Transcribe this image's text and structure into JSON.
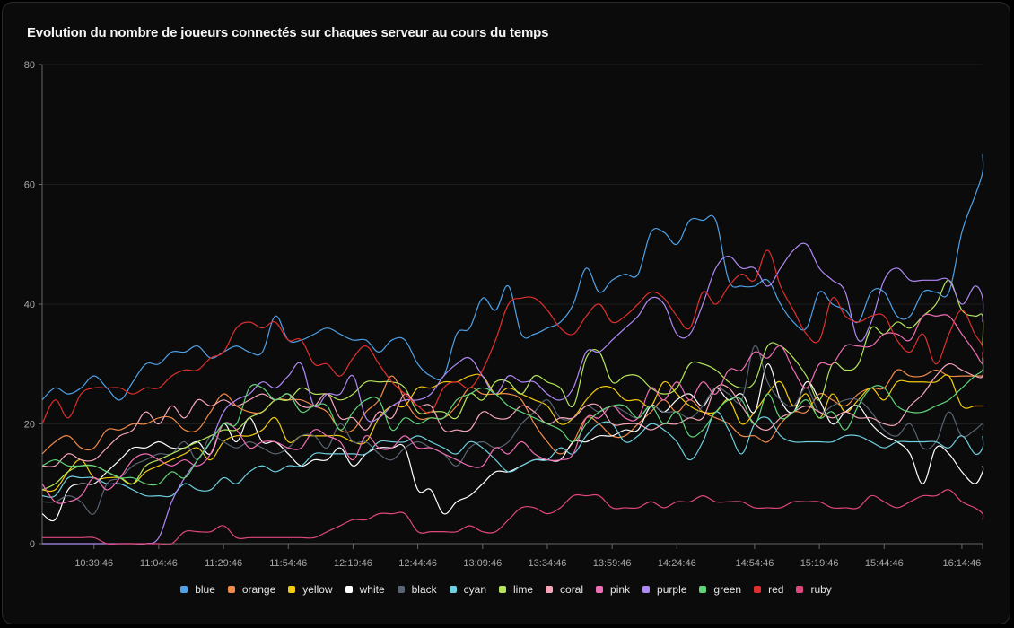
{
  "panel": {
    "title": "Evolution du nombre de joueurs connectés sur chaques serveur au cours du temps"
  },
  "chart_data": {
    "type": "line",
    "title": "Evolution du nombre de joueurs connectés sur chaques serveur au cours du temps",
    "xlabel": "",
    "ylabel": "",
    "ylim": [
      0,
      80
    ],
    "yticks": [
      0,
      20,
      40,
      60,
      80
    ],
    "xticks": [
      "10:39:46",
      "11:04:46",
      "11:29:46",
      "11:54:46",
      "12:19:46",
      "12:44:46",
      "13:09:46",
      "13:34:46",
      "13:59:46",
      "14:24:46",
      "14:54:46",
      "15:19:46",
      "15:44:46",
      "16:14:46"
    ],
    "x_start": "10:19:46",
    "x_step_minutes": 5,
    "x_domain": [
      "10:19:46",
      "16:22:46"
    ],
    "grid": true,
    "legend_position": "bottom",
    "series": [
      {
        "name": "blue",
        "color": "#4ea2e8",
        "values": [
          24,
          26,
          25,
          26,
          28,
          26,
          24,
          27,
          30,
          30,
          32,
          32,
          33,
          31,
          32,
          33,
          32,
          32,
          38,
          34,
          34,
          35,
          36,
          35,
          34,
          34,
          32,
          34,
          34,
          30,
          28,
          28,
          35,
          36,
          41,
          39,
          43,
          35,
          35,
          36,
          37,
          40,
          46,
          42,
          44,
          45,
          45,
          52,
          52,
          50,
          54,
          54,
          54,
          44,
          43,
          43,
          44,
          40,
          37,
          36,
          42,
          40,
          39,
          37,
          42,
          42,
          38,
          38,
          42,
          42,
          42,
          52,
          58,
          62,
          65
        ]
      },
      {
        "name": "orange",
        "color": "#f08a47",
        "values": [
          15,
          17,
          18,
          16,
          16,
          19,
          19,
          20,
          20,
          21,
          21,
          19,
          19,
          22,
          25,
          23,
          22,
          22,
          24,
          24,
          24,
          23,
          22,
          19,
          19,
          22,
          24,
          28,
          24,
          21,
          21,
          21,
          23,
          26,
          25,
          25,
          25,
          24,
          20,
          17,
          15,
          17,
          21,
          20,
          18,
          18,
          20,
          22,
          24,
          22,
          24,
          22,
          21,
          20,
          18,
          18,
          17,
          20,
          22,
          22,
          25,
          24,
          23,
          25,
          26,
          26,
          29,
          28,
          28,
          29,
          28,
          28,
          28,
          28,
          28
        ]
      },
      {
        "name": "yellow",
        "color": "#f2cc0c",
        "values": [
          9,
          9,
          12,
          14,
          11,
          11,
          11,
          10,
          12,
          13,
          14,
          15,
          16,
          14,
          17,
          18,
          18,
          19,
          21,
          17,
          18,
          18,
          18,
          18,
          17,
          17,
          21,
          23,
          23,
          26,
          26,
          27,
          27,
          28,
          28,
          25,
          26,
          25,
          24,
          23,
          20,
          21,
          24,
          26,
          26,
          24,
          24,
          23,
          27,
          25,
          23,
          22,
          22,
          24,
          20,
          22,
          25,
          27,
          23,
          25,
          21,
          25,
          22,
          24,
          26,
          24,
          27,
          27,
          27,
          27,
          28,
          23,
          23,
          23,
          23
        ]
      },
      {
        "name": "white",
        "color": "#ffffff",
        "values": [
          5,
          4,
          9,
          10,
          10,
          12,
          14,
          16,
          16,
          17,
          16,
          16,
          17,
          15,
          20,
          17,
          21,
          17,
          17,
          15,
          13,
          14,
          14,
          16,
          13,
          15,
          16,
          16,
          16,
          9,
          9,
          5,
          7,
          8,
          10,
          12,
          12,
          13,
          14,
          14,
          14,
          17,
          17,
          18,
          18,
          19,
          19,
          23,
          22,
          24,
          25,
          23,
          26,
          24,
          25,
          22,
          30,
          24,
          22,
          27,
          24,
          20,
          22,
          23,
          20,
          18,
          17,
          15,
          10,
          16,
          15,
          12,
          10,
          12,
          13
        ]
      },
      {
        "name": "black",
        "color": "#5a6472",
        "values": [
          7,
          7,
          8,
          7,
          5,
          10,
          11,
          13,
          14,
          15,
          15,
          17,
          14,
          18,
          17,
          16,
          17,
          16,
          15,
          16,
          18,
          18,
          16,
          20,
          17,
          17,
          15,
          14,
          16,
          17,
          16,
          15,
          13,
          16,
          17,
          16,
          17,
          20,
          22,
          24,
          21,
          21,
          23,
          22,
          23,
          22,
          21,
          23,
          22,
          22,
          21,
          23,
          26,
          25,
          24,
          33,
          27,
          24,
          23,
          26,
          22,
          23,
          24,
          24,
          22,
          19,
          18,
          20,
          16,
          17,
          22,
          18,
          19,
          20,
          19
        ]
      },
      {
        "name": "cyan",
        "color": "#6ed0e0",
        "values": [
          8,
          8,
          11,
          11,
          11,
          10,
          10,
          9,
          8,
          8,
          8,
          10,
          9,
          9,
          11,
          10,
          12,
          13,
          12,
          13,
          13,
          15,
          15,
          15,
          15,
          15,
          17,
          17,
          17,
          18,
          17,
          16,
          15,
          17,
          16,
          14,
          12,
          13,
          14,
          14,
          16,
          15,
          18,
          20,
          20,
          17,
          18,
          20,
          19,
          17,
          14,
          17,
          22,
          19,
          15,
          20,
          21,
          18,
          17,
          17,
          17,
          17,
          18,
          18,
          17,
          16,
          17,
          17,
          17,
          17,
          16,
          18,
          15,
          16,
          18
        ]
      },
      {
        "name": "lime",
        "color": "#b4e55a",
        "values": [
          9,
          10,
          12,
          13,
          13,
          12,
          11,
          10,
          13,
          14,
          15,
          16,
          17,
          18,
          19,
          19,
          21,
          22,
          24,
          24,
          26,
          25,
          25,
          24,
          25,
          27,
          27,
          27,
          26,
          22,
          22,
          22,
          21,
          25,
          24,
          27,
          27,
          25,
          28,
          27,
          26,
          23,
          31,
          32,
          27,
          28,
          28,
          26,
          25,
          26,
          30,
          30,
          29,
          27,
          26,
          27,
          33,
          33,
          31,
          28,
          24,
          30,
          29,
          30,
          36,
          35,
          37,
          36,
          38,
          40,
          44,
          39,
          38,
          38,
          33
        ]
      },
      {
        "name": "coral",
        "color": "#f5a6b8",
        "values": [
          13,
          13,
          15,
          14,
          14,
          16,
          18,
          19,
          22,
          20,
          23,
          21,
          24,
          23,
          24,
          23,
          24,
          25,
          24,
          25,
          23,
          23,
          25,
          21,
          21,
          19,
          22,
          21,
          25,
          23,
          23,
          19,
          19,
          19,
          22,
          21,
          21,
          23,
          22,
          20,
          21,
          21,
          23,
          23,
          20,
          20,
          20,
          19,
          20,
          20,
          21,
          21,
          26,
          26,
          23,
          20,
          19,
          21,
          22,
          23,
          22,
          21,
          22,
          21,
          21,
          20,
          20,
          23,
          25,
          28,
          30,
          29,
          28,
          28,
          31
        ]
      },
      {
        "name": "pink",
        "color": "#f06eb4",
        "values": [
          10,
          7,
          7,
          8,
          11,
          9,
          11,
          14,
          15,
          14,
          13,
          14,
          13,
          15,
          20,
          19,
          16,
          17,
          17,
          16,
          16,
          19,
          18,
          17,
          14,
          18,
          16,
          16,
          18,
          16,
          16,
          15,
          14,
          13,
          13,
          16,
          15,
          17,
          15,
          14,
          14,
          15,
          21,
          21,
          23,
          21,
          21,
          26,
          24,
          27,
          24,
          27,
          25,
          29,
          29,
          32,
          31,
          33,
          29,
          26,
          30,
          30,
          33,
          33,
          33,
          35,
          35,
          34,
          38,
          38,
          38,
          35,
          32,
          30,
          32
        ]
      },
      {
        "name": "purple",
        "color": "#b189f5",
        "values": [
          0,
          0,
          0,
          0,
          0,
          0,
          0,
          0,
          0,
          1,
          7,
          11,
          14,
          17,
          22,
          24,
          25,
          27,
          26,
          28,
          30,
          23,
          25,
          25,
          28,
          21,
          21,
          23,
          24,
          24,
          25,
          28,
          30,
          31,
          28,
          25,
          28,
          27,
          27,
          25,
          24,
          26,
          32,
          32,
          34,
          36,
          38,
          41,
          40,
          35,
          35,
          40,
          46,
          48,
          46,
          46,
          43,
          46,
          49,
          50,
          46,
          44,
          42,
          34,
          37,
          44,
          46,
          44,
          44,
          44,
          44,
          40,
          43,
          41,
          37
        ]
      },
      {
        "name": "green",
        "color": "#5fd57a",
        "values": [
          13,
          14,
          13,
          13,
          13,
          12,
          11,
          11,
          10,
          10,
          12,
          11,
          14,
          17,
          20,
          20,
          26,
          26,
          24,
          25,
          22,
          23,
          23,
          19,
          22,
          24,
          24,
          19,
          21,
          20,
          21,
          21,
          24,
          25,
          26,
          25,
          23,
          22,
          21,
          20,
          19,
          17,
          20,
          22,
          23,
          23,
          21,
          23,
          20,
          22,
          18,
          19,
          22,
          24,
          24,
          20,
          25,
          21,
          22,
          24,
          21,
          22,
          19,
          23,
          26,
          26,
          23,
          22,
          22,
          23,
          24,
          26,
          28,
          29,
          31
        ]
      },
      {
        "name": "red",
        "color": "#e02f2f",
        "values": [
          20,
          24,
          21,
          25,
          26,
          26,
          26,
          25,
          26,
          26,
          28,
          29,
          29,
          31,
          32,
          36,
          37,
          36,
          37,
          34,
          34,
          30,
          30,
          28,
          31,
          33,
          30,
          27,
          25,
          23,
          22,
          26,
          27,
          26,
          29,
          34,
          40,
          41,
          41,
          39,
          36,
          35,
          38,
          40,
          37,
          38,
          40,
          42,
          41,
          38,
          36,
          42,
          40,
          43,
          45,
          44,
          49,
          43,
          39,
          35,
          34,
          41,
          38,
          37,
          38,
          38,
          34,
          32,
          35,
          30,
          35,
          39,
          35,
          33,
          31
        ]
      },
      {
        "name": "ruby",
        "color": "#e0477f",
        "values": [
          1,
          1,
          1,
          1,
          1,
          0,
          0,
          0,
          0,
          0,
          0,
          2,
          2,
          2,
          3,
          1,
          1,
          1,
          1,
          1,
          1,
          1,
          2,
          3,
          4,
          4,
          5,
          5,
          5,
          2,
          2,
          2,
          2,
          3,
          2,
          2,
          4,
          6,
          6,
          5,
          6,
          8,
          8,
          8,
          6,
          6,
          6,
          7,
          6,
          7,
          7,
          8,
          7,
          7,
          7,
          6,
          6,
          6,
          7,
          7,
          7,
          6,
          6,
          6,
          8,
          7,
          6,
          7,
          8,
          8,
          9,
          7,
          6,
          5,
          4
        ]
      }
    ]
  }
}
